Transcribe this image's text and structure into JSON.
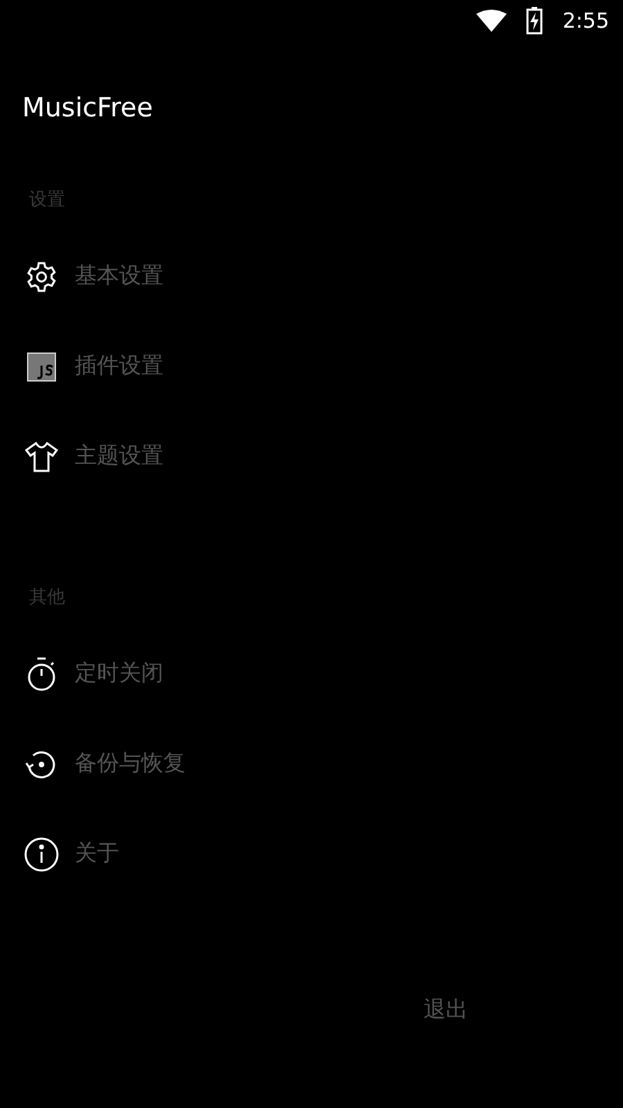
{
  "status_bar": {
    "time": "2:55"
  },
  "app_title": "MusicFree",
  "sections": [
    {
      "title": "设置",
      "items": [
        {
          "label": "基本设置"
        },
        {
          "label": "插件设置"
        },
        {
          "label": "主题设置"
        }
      ]
    },
    {
      "title": "其他",
      "items": [
        {
          "label": "定时关闭"
        },
        {
          "label": "备份与恢复"
        },
        {
          "label": "关于"
        }
      ]
    }
  ],
  "exit_button": "退出"
}
